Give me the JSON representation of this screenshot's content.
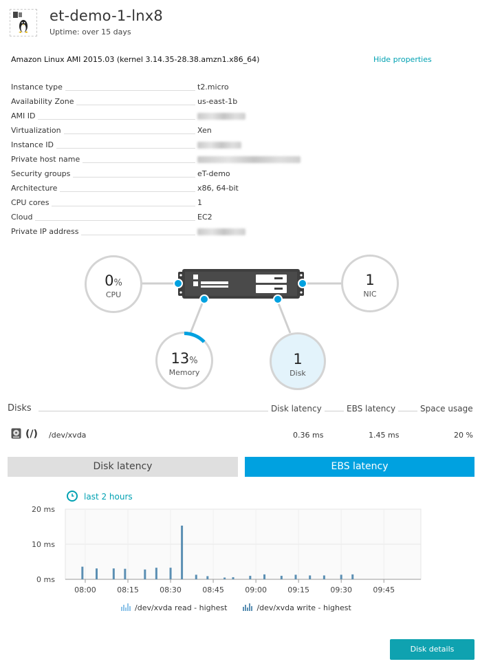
{
  "header": {
    "title": "et-demo-1-lnx8",
    "uptime": "Uptime: over 15 days"
  },
  "os": "Amazon Linux AMI 2015.03 (kernel 3.14.35-28.38.amzn1.x86_64)",
  "hide_properties": "Hide properties",
  "properties": [
    {
      "label": "Instance type",
      "value": "t2.micro"
    },
    {
      "label": "Availability Zone",
      "value": "us-east-1b"
    },
    {
      "label": "AMI ID",
      "value": ""
    },
    {
      "label": "Virtualization",
      "value": "Xen"
    },
    {
      "label": "Instance ID",
      "value": ""
    },
    {
      "label": "Private host name",
      "value": ""
    },
    {
      "label": "Security groups",
      "value": "eT-demo"
    },
    {
      "label": "Architecture",
      "value": "x86, 64-bit"
    },
    {
      "label": "CPU cores",
      "value": "1"
    },
    {
      "label": "Cloud",
      "value": "EC2"
    },
    {
      "label": "Private IP address",
      "value": ""
    }
  ],
  "infographic": {
    "cpu": {
      "value": "0",
      "unit": "%",
      "label": "CPU"
    },
    "nic": {
      "value": "1",
      "label": "NIC"
    },
    "memory": {
      "value": "13",
      "unit": "%",
      "label": "Memory",
      "fraction": 0.13
    },
    "disk": {
      "value": "1",
      "label": "Disk"
    }
  },
  "disks": {
    "title": "Disks",
    "columns": [
      "Disk latency",
      "EBS latency",
      "Space usage"
    ],
    "rows": [
      {
        "mount": "(/)",
        "device": "/dev/xvda",
        "disk_latency": "0.36 ms",
        "ebs_latency": "1.45 ms",
        "space_usage": "20 %"
      }
    ]
  },
  "tabs": [
    "Disk latency",
    "EBS latency"
  ],
  "active_tab": "EBS latency",
  "time_range": "last 2 hours",
  "chart_data": {
    "type": "bar",
    "x": [
      "07:59",
      "08:04",
      "08:10",
      "08:14",
      "08:21",
      "08:25",
      "08:30",
      "08:34",
      "08:39",
      "08:43",
      "08:49",
      "08:52",
      "08:58",
      "09:03",
      "09:09",
      "09:14",
      "09:19",
      "09:24",
      "09:30",
      "09:34"
    ],
    "series": [
      {
        "name": "/dev/xvda read - highest",
        "values": [
          3.6,
          3.1,
          3.1,
          3.0,
          2.8,
          3.3,
          3.3,
          15.3,
          1.3,
          0.9,
          0.5,
          0.6,
          1.0,
          1.4,
          1.0,
          1.3,
          1.1,
          1.1,
          1.3,
          1.4
        ]
      }
    ],
    "x_ticks": [
      "08:00",
      "08:15",
      "08:30",
      "08:45",
      "09:00",
      "09:15",
      "09:30",
      "09:45"
    ],
    "y_ticks": [
      "0 ms",
      "10 ms",
      "20 ms"
    ],
    "ylim": [
      0,
      20
    ],
    "grid": true,
    "legend": [
      "/dev/xvda read - highest",
      "/dev/xvda write - highest"
    ],
    "legend_position": "bottom"
  },
  "colors": {
    "accent": "#00a1e0",
    "teal": "#0fa2b0",
    "bar": "#5b8fb3"
  },
  "disk_details_button": "Disk details"
}
